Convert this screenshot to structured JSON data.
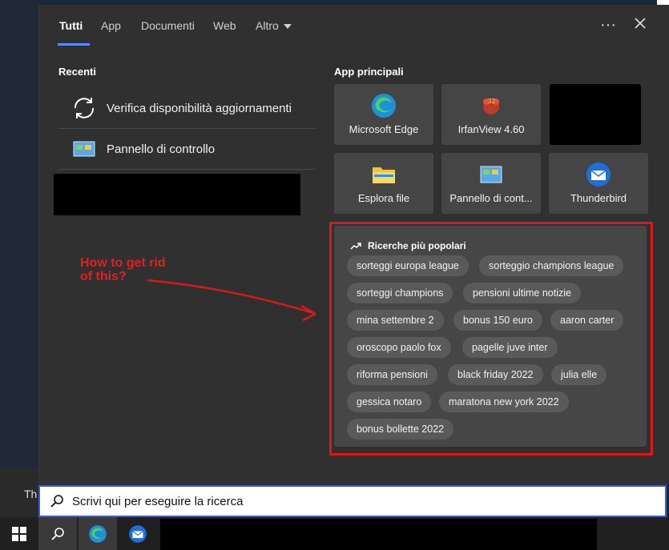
{
  "tabs": [
    {
      "label": "Tutti",
      "active": true
    },
    {
      "label": "App"
    },
    {
      "label": "Documenti"
    },
    {
      "label": "Web"
    },
    {
      "label": "Altro"
    }
  ],
  "recent": {
    "title": "Recenti",
    "items": [
      {
        "label": "Verifica disponibilità aggiornamenti",
        "icon": "refresh-icon"
      },
      {
        "label": "Pannello di controllo",
        "icon": "control-panel-icon"
      }
    ]
  },
  "top_apps": {
    "title": "App principali",
    "items": [
      {
        "label": "Microsoft Edge",
        "icon": "edge-icon"
      },
      {
        "label": "IrfanView 4.60",
        "icon": "irfanview-icon"
      },
      {
        "label": "",
        "icon": "redacted"
      },
      {
        "label": "Esplora file",
        "icon": "folder-icon"
      },
      {
        "label": "Pannello di cont...",
        "icon": "control-panel-icon"
      },
      {
        "label": "Thunderbird",
        "icon": "thunderbird-icon"
      }
    ]
  },
  "popular": {
    "title": "Ricerche più popolari",
    "chips": [
      "sorteggi europa league",
      "sorteggio champions league",
      "sorteggi champions",
      "pensioni ultime notizie",
      "mina settembre 2",
      "bonus 150 euro",
      "aaron carter",
      "oroscopo paolo fox",
      "pagelle juve inter",
      "riforma pensioni",
      "black friday 2022",
      "julia elle",
      "gessica notaro",
      "maratona new york 2022",
      "bonus bollette 2022"
    ]
  },
  "annotation": {
    "line1": "How to get rid",
    "line2": "of this?"
  },
  "search": {
    "placeholder": "Scrivi qui per eseguire la ricerca"
  },
  "background": {
    "partial_text": "Th"
  },
  "colors": {
    "accent": "#5b8cff",
    "annotation": "#d81a1a",
    "panel": "#303030"
  }
}
